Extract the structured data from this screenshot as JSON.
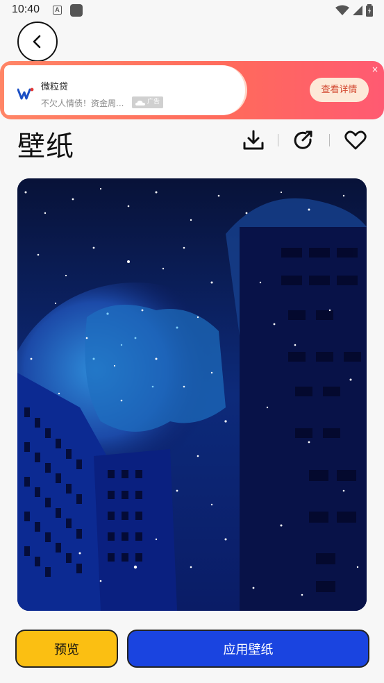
{
  "status_bar": {
    "time": "10:40",
    "notification_letter": "A"
  },
  "ad": {
    "title": "微粒贷",
    "description": "不欠人情债！资金周...",
    "tag": "广告",
    "cta": "查看详情",
    "close": "×"
  },
  "page": {
    "title": "壁纸"
  },
  "buttons": {
    "preview": "预览",
    "apply": "应用壁纸"
  },
  "colors": {
    "preview_button": "#fbbf12",
    "apply_button": "#1a44e0",
    "ad_gradient": "#ff6a5c"
  },
  "icons": {
    "back": "chevron-left-icon",
    "download": "download-icon",
    "share": "share-icon",
    "favorite": "heart-icon"
  }
}
